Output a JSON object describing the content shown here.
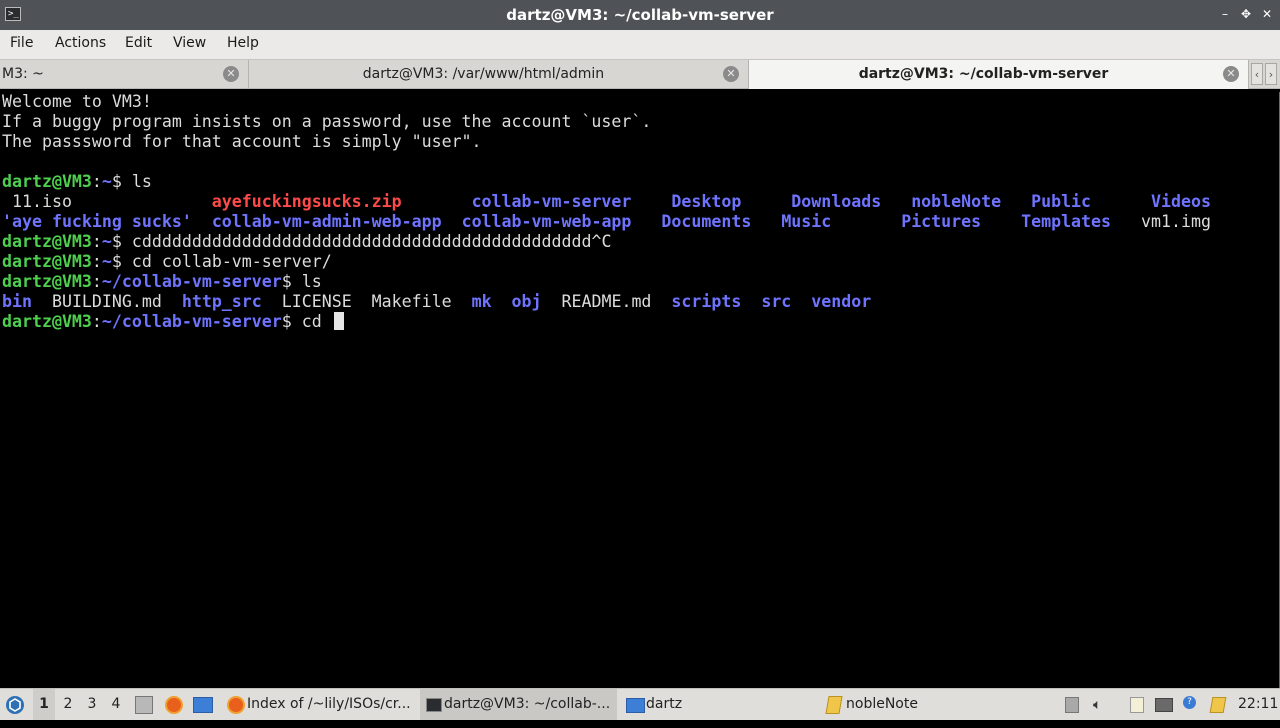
{
  "window": {
    "title": "dartz@VM3: ~/collab-vm-server",
    "app_icon_glyph": ">_",
    "controls": {
      "minimize": "–",
      "maximize": "✥",
      "close": "✕"
    }
  },
  "menu": {
    "items": [
      {
        "id": "file",
        "label": "File"
      },
      {
        "id": "actions",
        "label": "Actions"
      },
      {
        "id": "edit",
        "label": "Edit"
      },
      {
        "id": "view",
        "label": "View"
      },
      {
        "id": "help",
        "label": "Help"
      }
    ]
  },
  "tabs": {
    "items": [
      {
        "label": "M3: ~",
        "active": false
      },
      {
        "label": "dartz@VM3: /var/www/html/admin",
        "active": false
      },
      {
        "label": "dartz@VM3: ~/collab-vm-server",
        "active": true
      }
    ],
    "close_glyph": "✕",
    "scroll_left": "‹",
    "scroll_right": "›"
  },
  "terminal": {
    "lines": [
      [
        {
          "t": "Welcome to VM3!",
          "c": "c-file"
        }
      ],
      [
        {
          "t": "If a buggy program insists on a password, use the account `user`.",
          "c": "c-file"
        }
      ],
      [
        {
          "t": "The passsword for that account is simply \"user\".",
          "c": "c-file"
        }
      ],
      [],
      [
        {
          "t": "dartz@VM3",
          "c": "prompt-user"
        },
        {
          "t": ":",
          "c": "c-file"
        },
        {
          "t": "~",
          "c": "prompt-path"
        },
        {
          "t": "$ ls",
          "c": "c-file"
        }
      ],
      [
        {
          "t": " 11.iso              ",
          "c": "c-file"
        },
        {
          "t": "ayefuckingsucks.zip",
          "c": "c-zip"
        },
        {
          "t": "       ",
          "c": "c-file"
        },
        {
          "t": "collab-vm-server",
          "c": "c-dir"
        },
        {
          "t": "    ",
          "c": "c-file"
        },
        {
          "t": "Desktop",
          "c": "c-dir"
        },
        {
          "t": "     ",
          "c": "c-file"
        },
        {
          "t": "Downloads",
          "c": "c-dir"
        },
        {
          "t": "   ",
          "c": "c-file"
        },
        {
          "t": "nobleNote",
          "c": "c-dir"
        },
        {
          "t": "   ",
          "c": "c-file"
        },
        {
          "t": "Public",
          "c": "c-dir"
        },
        {
          "t": "      ",
          "c": "c-file"
        },
        {
          "t": "Videos",
          "c": "c-dir"
        }
      ],
      [
        {
          "t": "'aye fucking sucks'",
          "c": "c-dir"
        },
        {
          "t": "  ",
          "c": "c-file"
        },
        {
          "t": "collab-vm-admin-web-app",
          "c": "c-dir"
        },
        {
          "t": "  ",
          "c": "c-file"
        },
        {
          "t": "collab-vm-web-app",
          "c": "c-dir"
        },
        {
          "t": "   ",
          "c": "c-file"
        },
        {
          "t": "Documents",
          "c": "c-dir"
        },
        {
          "t": "   ",
          "c": "c-file"
        },
        {
          "t": "Music",
          "c": "c-dir"
        },
        {
          "t": "       ",
          "c": "c-file"
        },
        {
          "t": "Pictures",
          "c": "c-dir"
        },
        {
          "t": "    ",
          "c": "c-file"
        },
        {
          "t": "Templates",
          "c": "c-dir"
        },
        {
          "t": "   vm1.img",
          "c": "c-file"
        }
      ],
      [
        {
          "t": "dartz@VM3",
          "c": "prompt-user"
        },
        {
          "t": ":",
          "c": "c-file"
        },
        {
          "t": "~",
          "c": "prompt-path"
        },
        {
          "t": "$ cddddddddddddddddddddddddddddddddddddddddddddd^C",
          "c": "c-file"
        }
      ],
      [
        {
          "t": "dartz@VM3",
          "c": "prompt-user"
        },
        {
          "t": ":",
          "c": "c-file"
        },
        {
          "t": "~",
          "c": "prompt-path"
        },
        {
          "t": "$ cd collab-vm-server/",
          "c": "c-file"
        }
      ],
      [
        {
          "t": "dartz@VM3",
          "c": "prompt-user"
        },
        {
          "t": ":",
          "c": "c-file"
        },
        {
          "t": "~/collab-vm-server",
          "c": "prompt-path"
        },
        {
          "t": "$ ls",
          "c": "c-file"
        }
      ],
      [
        {
          "t": "bin",
          "c": "c-dir"
        },
        {
          "t": "  BUILDING.md  ",
          "c": "c-file"
        },
        {
          "t": "http_src",
          "c": "c-dir"
        },
        {
          "t": "  LICENSE  Makefile  ",
          "c": "c-file"
        },
        {
          "t": "mk",
          "c": "c-dir"
        },
        {
          "t": "  ",
          "c": "c-file"
        },
        {
          "t": "obj",
          "c": "c-dir"
        },
        {
          "t": "  README.md  ",
          "c": "c-file"
        },
        {
          "t": "scripts",
          "c": "c-dir"
        },
        {
          "t": "  ",
          "c": "c-file"
        },
        {
          "t": "src",
          "c": "c-dir"
        },
        {
          "t": "  ",
          "c": "c-file"
        },
        {
          "t": "vendor",
          "c": "c-dir"
        }
      ],
      [
        {
          "t": "dartz@VM3",
          "c": "prompt-user"
        },
        {
          "t": ":",
          "c": "c-file"
        },
        {
          "t": "~/collab-vm-server",
          "c": "prompt-path"
        },
        {
          "t": "$ cd ",
          "c": "c-file"
        }
      ]
    ]
  },
  "taskbar": {
    "workspaces": [
      "1",
      "2",
      "3",
      "4"
    ],
    "active_workspace": "1",
    "tasks": [
      {
        "label": "Index of /~lily/ISOs/cr...",
        "icon": "firefox-icon",
        "active": false
      },
      {
        "label": "dartz@VM3: ~/collab-...",
        "icon": "terminal-icon",
        "active": true
      },
      {
        "label": "dartz",
        "icon": "folder-icon",
        "active": false
      },
      {
        "label": "nobleNote",
        "icon": "note-icon",
        "active": false
      }
    ],
    "clock": "22:11",
    "colors": {
      "start": "#2e6fb5",
      "firefox": "#e8601c",
      "folder": "#3d7fd6",
      "note": "#f0c64a"
    }
  }
}
